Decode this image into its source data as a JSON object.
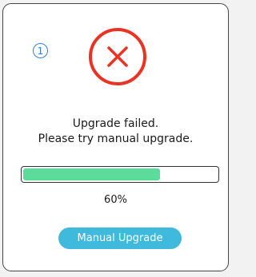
{
  "dialog": {
    "step_badge": "1",
    "status_icon": "error-x-circle-icon",
    "message_line1": "Upgrade failed.",
    "message_line2": "Please try manual upgrade.",
    "progress": {
      "fraction": 0.6,
      "label": "60%"
    },
    "action_button_label": "Manual Upgrade"
  },
  "colors": {
    "error_red": "#ea3323",
    "progress_green": "#5cdc9a",
    "button_blue": "#3fbadd",
    "badge_blue": "#2f7fd0"
  }
}
